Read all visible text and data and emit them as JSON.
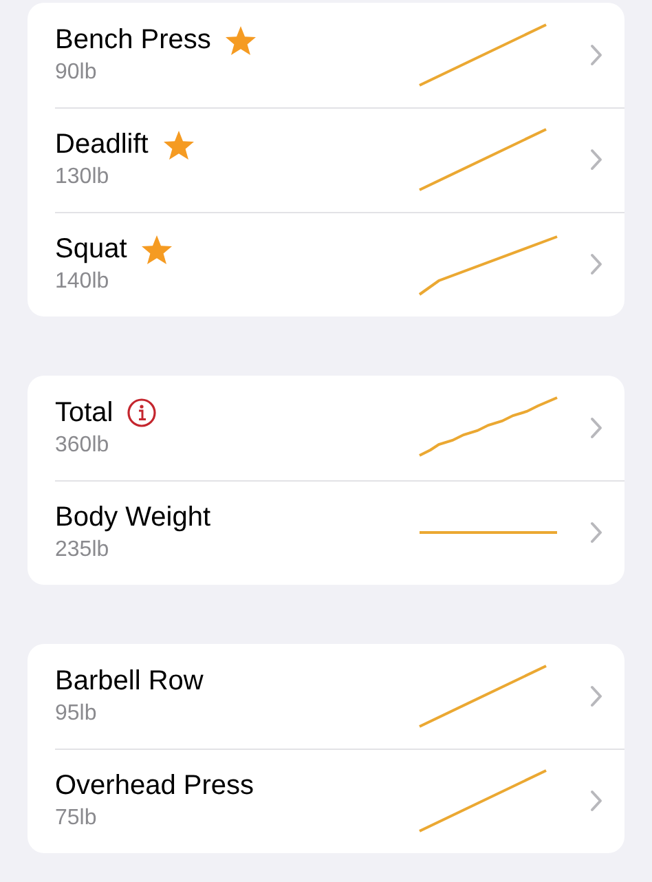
{
  "sections": [
    {
      "rows": [
        {
          "title": "Bench Press",
          "badge": {
            "kind": "star"
          },
          "value": "90lb",
          "sparkline": {
            "kind": "rising"
          }
        },
        {
          "title": "Deadlift",
          "badge": {
            "kind": "star"
          },
          "value": "130lb",
          "sparkline": {
            "kind": "rising"
          }
        },
        {
          "title": "Squat",
          "badge": {
            "kind": "star"
          },
          "value": "140lb",
          "sparkline": {
            "kind": "bent"
          }
        }
      ]
    },
    {
      "rows": [
        {
          "title": "Total",
          "badge": {
            "kind": "info"
          },
          "value": "360lb",
          "sparkline": {
            "kind": "jagged"
          }
        },
        {
          "title": "Body Weight",
          "value": "235lb",
          "sparkline": {
            "kind": "flat"
          }
        }
      ]
    },
    {
      "rows": [
        {
          "title": "Barbell Row",
          "value": "95lb",
          "sparkline": {
            "kind": "rising"
          }
        },
        {
          "title": "Overhead Press",
          "value": "75lb",
          "sparkline": {
            "kind": "rising"
          }
        }
      ]
    }
  ]
}
